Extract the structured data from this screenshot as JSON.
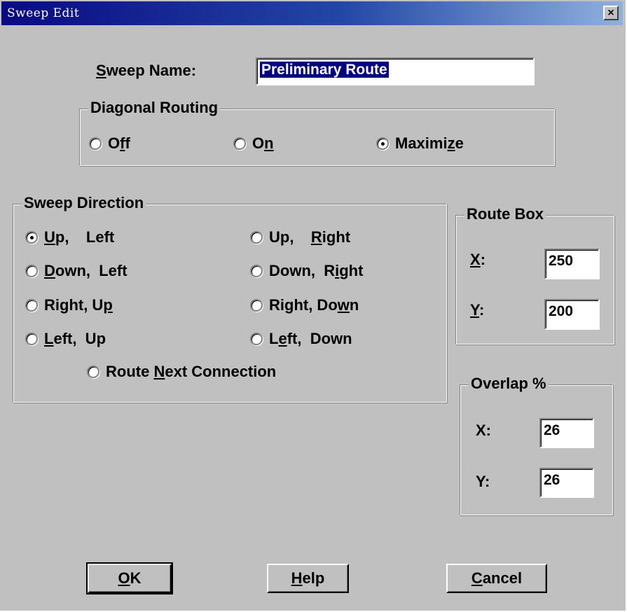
{
  "window": {
    "title": "Sweep Edit",
    "close_glyph": "×"
  },
  "sweep_name": {
    "label_u": "S",
    "label_rest": "weep Name:",
    "value": "Preliminary Route"
  },
  "diagonal_routing": {
    "legend": "Diagonal Routing",
    "options": [
      {
        "pre": "O",
        "u": "f",
        "post": "f",
        "selected": false
      },
      {
        "pre": "O",
        "u": "n",
        "post": "",
        "selected": false
      },
      {
        "pre": "Maximi",
        "u": "z",
        "post": "e",
        "selected": true
      }
    ]
  },
  "sweep_direction": {
    "legend": "Sweep Direction",
    "options": [
      {
        "pre": "",
        "u": "U",
        "post": "p,    Left",
        "selected": true
      },
      {
        "pre": "Up,    ",
        "u": "R",
        "post": "ight",
        "selected": false
      },
      {
        "pre": "",
        "u": "D",
        "post": "own,  Left",
        "selected": false
      },
      {
        "pre": "Down,  R",
        "u": "i",
        "post": "ght",
        "selected": false
      },
      {
        "pre": "Right, U",
        "u": "p",
        "post": "",
        "selected": false
      },
      {
        "pre": "Right, Do",
        "u": "w",
        "post": "n",
        "selected": false
      },
      {
        "pre": "",
        "u": "L",
        "post": "eft,  Up",
        "selected": false
      },
      {
        "pre": "L",
        "u": "e",
        "post": "ft,  Down",
        "selected": false
      },
      {
        "pre": "Route ",
        "u": "N",
        "post": "ext Connection",
        "selected": false
      }
    ]
  },
  "route_box": {
    "legend": "Route Box",
    "x_label_u": "X",
    "x_label_rest": ":",
    "x_value": "250",
    "y_label_u": "Y",
    "y_label_rest": ":",
    "y_value": "200"
  },
  "overlap": {
    "legend": "Overlap %",
    "x_label": "X:",
    "x_value": "26",
    "y_label": "Y:",
    "y_value": "26"
  },
  "buttons": {
    "ok": {
      "u": "O",
      "rest": "K"
    },
    "help": {
      "u": "H",
      "rest": "elp"
    },
    "cancel": {
      "u": "C",
      "rest": "ancel"
    }
  }
}
